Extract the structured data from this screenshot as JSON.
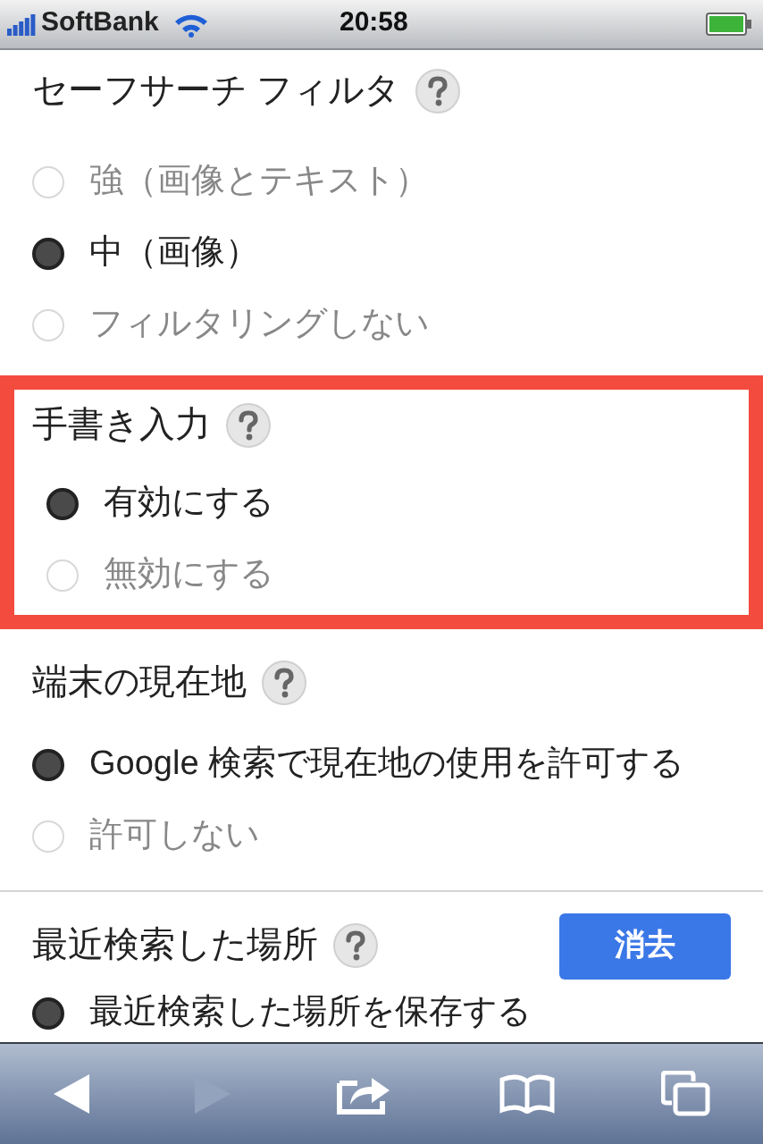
{
  "status_bar": {
    "carrier": "SoftBank",
    "time": "20:58"
  },
  "sections": [
    {
      "title": "セーフサーチ フィルタ",
      "highlighted": false,
      "options": [
        {
          "label": "強（画像とテキスト）",
          "selected": false
        },
        {
          "label": "中（画像）",
          "selected": true
        },
        {
          "label": "フィルタリングしない",
          "selected": false
        }
      ]
    },
    {
      "title": "手書き入力",
      "highlighted": true,
      "options": [
        {
          "label": "有効にする",
          "selected": true
        },
        {
          "label": "無効にする",
          "selected": false
        }
      ]
    },
    {
      "title": "端末の現在地",
      "highlighted": false,
      "options": [
        {
          "label": "Google 検索で現在地の使用を許可する",
          "selected": true
        },
        {
          "label": "許可しない",
          "selected": false
        }
      ]
    },
    {
      "title": "最近検索した場所",
      "highlighted": false,
      "button": "消去",
      "options": [
        {
          "label": "最近検索した場所を保存する",
          "selected": true
        }
      ]
    }
  ]
}
